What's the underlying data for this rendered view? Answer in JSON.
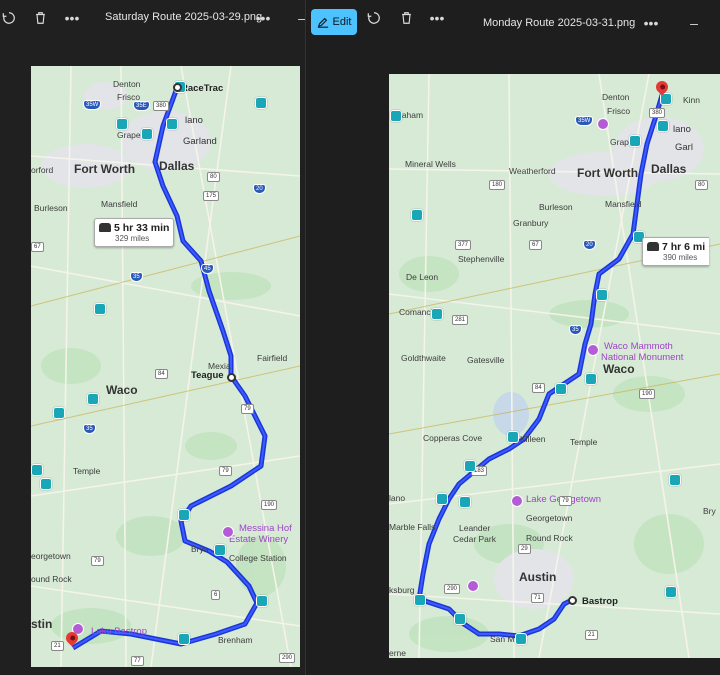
{
  "left": {
    "title": "Saturday Route 2025-03-29.png",
    "more": "•••",
    "route": {
      "time": "5 hr 33 min",
      "distance": "329 miles"
    },
    "places": [
      {
        "id": "denton",
        "t": "Denton"
      },
      {
        "id": "frisco",
        "t": "Frisco"
      },
      {
        "id": "racetrac",
        "t": "RaceTrac"
      },
      {
        "id": "plano",
        "t": "lano"
      },
      {
        "id": "garland",
        "t": "Garland"
      },
      {
        "id": "grape",
        "t": "Grape"
      },
      {
        "id": "fortworth",
        "t": "Fort Worth"
      },
      {
        "id": "dallas",
        "t": "Dallas"
      },
      {
        "id": "orford",
        "t": "orford"
      },
      {
        "id": "burleson",
        "t": "Burleson"
      },
      {
        "id": "mansfield",
        "t": "Mansfield"
      },
      {
        "id": "mexia",
        "t": "Mexia"
      },
      {
        "id": "teague",
        "t": "Teague"
      },
      {
        "id": "fairfield",
        "t": "Fairfield"
      },
      {
        "id": "waco",
        "t": "Waco"
      },
      {
        "id": "temple",
        "t": "Temple"
      },
      {
        "id": "messina",
        "t": "Messina Hof"
      },
      {
        "id": "messina2",
        "t": "Estate Winery"
      },
      {
        "id": "bryan",
        "t": "Brya"
      },
      {
        "id": "collegestation",
        "t": "College Station"
      },
      {
        "id": "georgetown",
        "t": "eorgetown"
      },
      {
        "id": "roundrock",
        "t": "ound Rock"
      },
      {
        "id": "brenham",
        "t": "Brenham"
      },
      {
        "id": "austin",
        "t": "stin"
      },
      {
        "id": "lbastrop",
        "t": "Lake Bastrop"
      }
    ],
    "shields": [
      "35W",
      "35E",
      "380",
      "80",
      "175",
      "20",
      "67",
      "35",
      "84",
      "45",
      "6",
      "79",
      "190",
      "290",
      "77",
      "21"
    ]
  },
  "right": {
    "title": "Monday Route 2025-03-31.png",
    "edit": "Edit",
    "more": "•••",
    "route": {
      "time": "7 hr 6 mi",
      "distance": "390 miles"
    },
    "places": [
      {
        "id": "graham",
        "t": "raham"
      },
      {
        "id": "denton",
        "t": "Denton"
      },
      {
        "id": "frisco",
        "t": "Frisco"
      },
      {
        "id": "kinn",
        "t": "Kinn"
      },
      {
        "id": "plano",
        "t": "lano"
      },
      {
        "id": "garl",
        "t": "Garl"
      },
      {
        "id": "grap",
        "t": "Grap"
      },
      {
        "id": "mineralwells",
        "t": "Mineral Wells"
      },
      {
        "id": "weatherford",
        "t": "Weatherford"
      },
      {
        "id": "fortworth",
        "t": "Fort Worth"
      },
      {
        "id": "dallas",
        "t": "Dallas"
      },
      {
        "id": "burleson",
        "t": "Burleson"
      },
      {
        "id": "mansfield",
        "t": "Mansfield"
      },
      {
        "id": "granbury",
        "t": "Granbury"
      },
      {
        "id": "stephenville",
        "t": "Stephenville"
      },
      {
        "id": "deleon",
        "t": "De Leon"
      },
      {
        "id": "comanche",
        "t": "Comanche"
      },
      {
        "id": "wacomm",
        "t": "Waco Mammoth"
      },
      {
        "id": "wacomm2",
        "t": "National Monument"
      },
      {
        "id": "goldthwaite",
        "t": "Goldthwaite"
      },
      {
        "id": "gatesville",
        "t": "Gatesville"
      },
      {
        "id": "waco",
        "t": "Waco"
      },
      {
        "id": "copperascove",
        "t": "Copperas Cove"
      },
      {
        "id": "killeen",
        "t": "Killeen"
      },
      {
        "id": "temple",
        "t": "Temple"
      },
      {
        "id": "lakegeorgetown",
        "t": "Lake Georgetown"
      },
      {
        "id": "llano",
        "t": "lano"
      },
      {
        "id": "leander",
        "t": "Leander"
      },
      {
        "id": "georgetown",
        "t": "Georgetown"
      },
      {
        "id": "marblefalls",
        "t": "Marble Falls"
      },
      {
        "id": "cedarpark",
        "t": "Cedar Park"
      },
      {
        "id": "roundrock",
        "t": "Round Rock"
      },
      {
        "id": "austin",
        "t": "Austin"
      },
      {
        "id": "bastrop",
        "t": "Bastrop"
      },
      {
        "id": "ksburg",
        "t": "ksburg"
      },
      {
        "id": "bry",
        "t": "Bry"
      },
      {
        "id": "erne",
        "t": "erne"
      },
      {
        "id": "sanm",
        "t": "San M"
      }
    ],
    "shields": [
      "35W",
      "380",
      "180",
      "80",
      "377",
      "67",
      "20",
      "281",
      "35",
      "84",
      "190",
      "183",
      "79",
      "29",
      "290",
      "71",
      "21"
    ]
  }
}
